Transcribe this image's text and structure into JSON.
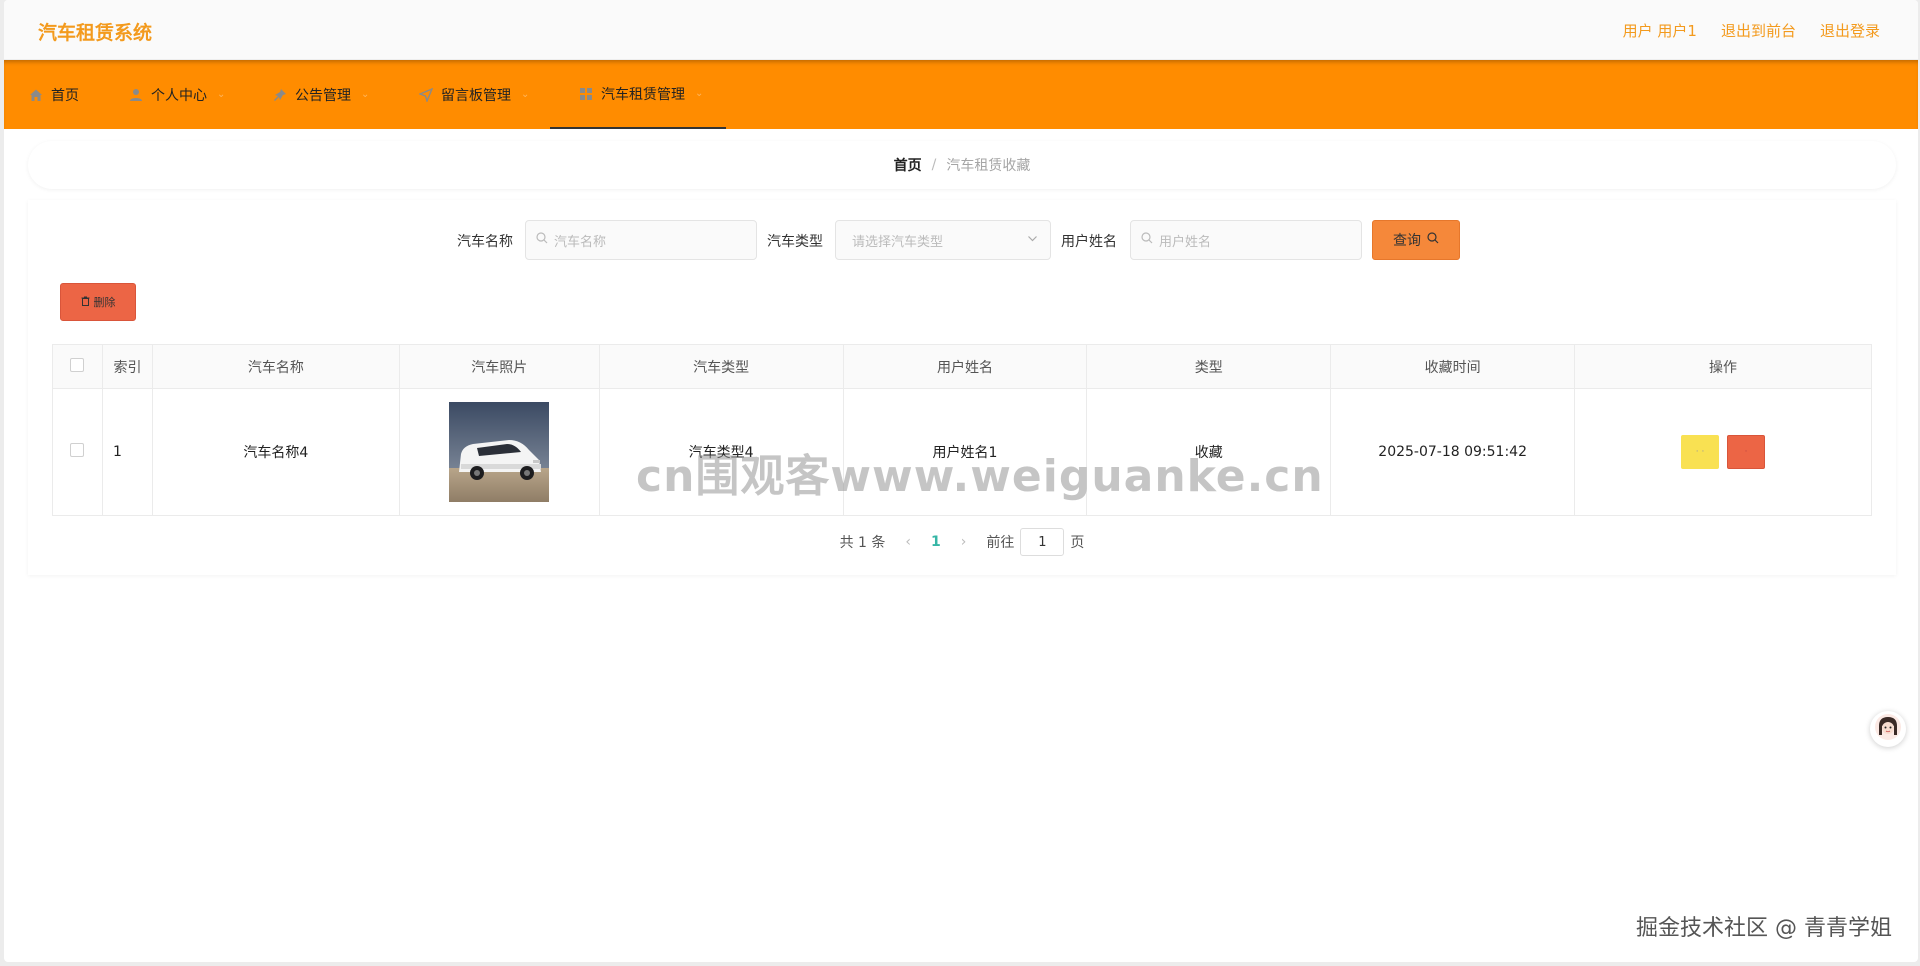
{
  "header": {
    "app_title": "汽车租赁系统",
    "user_label": "用户 用户1",
    "back_frontend": "退出到前台",
    "logout": "退出登录"
  },
  "nav": {
    "items": [
      {
        "label": "首页",
        "icon": "home-icon"
      },
      {
        "label": "个人中心",
        "icon": "user-icon"
      },
      {
        "label": "公告管理",
        "icon": "pin-icon"
      },
      {
        "label": "留言板管理",
        "icon": "send-icon"
      },
      {
        "label": "汽车租赁管理",
        "icon": "grid-icon"
      }
    ],
    "active_index": 4
  },
  "breadcrumb": {
    "home": "首页",
    "separator": "/",
    "current": "汽车租赁收藏"
  },
  "search": {
    "car_name_label": "汽车名称",
    "car_name_placeholder": "汽车名称",
    "car_type_label": "汽车类型",
    "car_type_placeholder": "请选择汽车类型",
    "user_name_label": "用户姓名",
    "user_name_placeholder": "用户姓名",
    "query_button": "查询"
  },
  "toolbar": {
    "delete_button": "删除"
  },
  "table": {
    "columns": [
      "索引",
      "汽车名称",
      "汽车照片",
      "汽车类型",
      "用户姓名",
      "类型",
      "收藏时间",
      "操作"
    ],
    "rows": [
      {
        "index": "1",
        "car_name": "汽车名称4",
        "car_type": "汽车类型4",
        "user_name": "用户姓名1",
        "type": "收藏",
        "time": "2025-07-18 09:51:42"
      }
    ]
  },
  "pagination": {
    "total": "共 1 条",
    "current_page": "1",
    "goto_prefix": "前往",
    "goto_value": "1",
    "goto_suffix": "页"
  },
  "watermark": "cn围观客www.weiguanke.cn",
  "footer_watermark": "掘金技术社区 @ 青青学姐",
  "colors": {
    "accent": "#f39a1d",
    "nav_bg": "#ff8c00",
    "query_btn": "#f5883a",
    "delete_btn": "#ec6545",
    "view_btn": "#f9e152",
    "page_active": "#36b6a6"
  }
}
